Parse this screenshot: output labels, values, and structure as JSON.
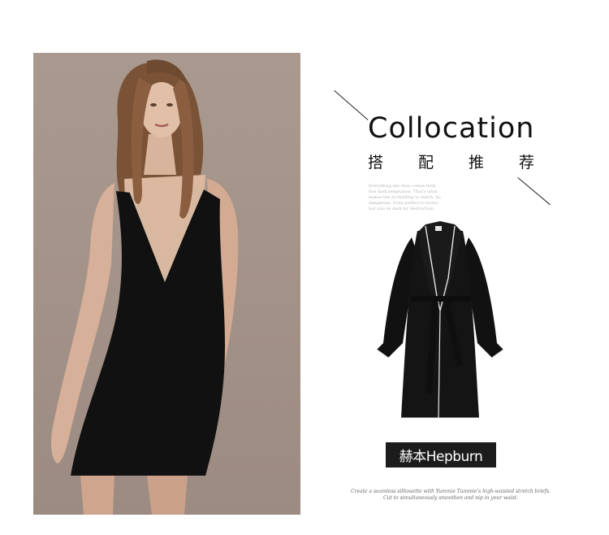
{
  "collocation": {
    "title": "Collocation",
    "subtitle_chars": [
      "搭",
      "配",
      "推",
      "荐"
    ],
    "blurb": "Everything she does comes from this dark temptation. That's what makes her so thrilling to watch. So dangerous. Even perfect to lovers but also so dark for destruction.",
    "badge": "赫本Hepburn",
    "caption_line1": "Create a seamless silhouette with Yummie Tummie's high-waisted stretch briefs.",
    "caption_line2": "Cut to simultaneously smoothen and nip in your waist."
  },
  "colors": {
    "background": "#ffffff",
    "photo_backdrop": "#a49389",
    "garment": "#111111",
    "lace": "#d8b9a0",
    "badge_bg": "#1c1c1c"
  }
}
